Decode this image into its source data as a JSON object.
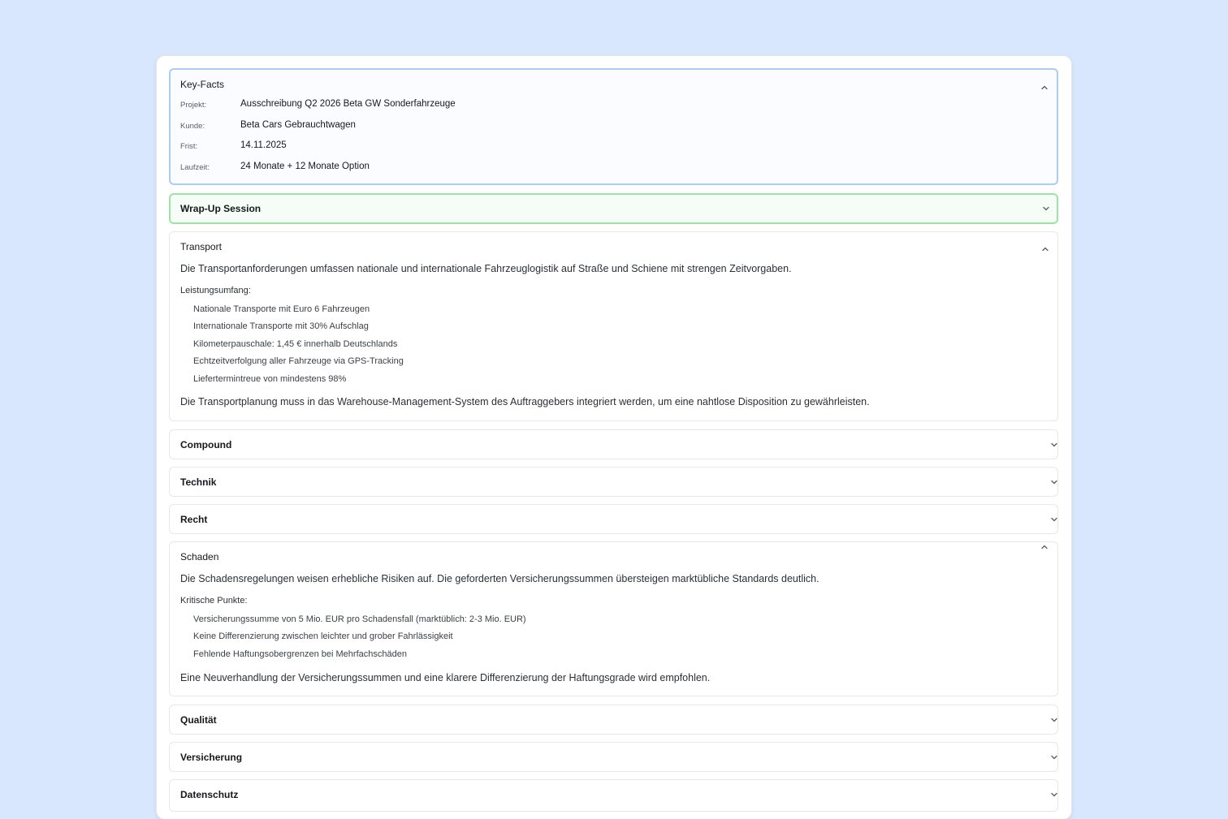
{
  "key_facts": {
    "title": "Key-Facts",
    "rows": [
      {
        "label": "Projekt:",
        "value": "Ausschreibung Q2 2026 Beta GW Sonderfahrzeuge"
      },
      {
        "label": "Kunde:",
        "value": "Beta Cars Gebrauchtwagen"
      },
      {
        "label": "Frist:",
        "value": "14.11.2025"
      },
      {
        "label": "Laufzeit:",
        "value": "24 Monate + 12 Monate Option"
      }
    ]
  },
  "wrap_up": {
    "title": "Wrap-Up Session"
  },
  "transport": {
    "title": "Transport",
    "intro": "Die Transportanforderungen umfassen nationale und internationale Fahrzeuglogistik auf Straße und Schiene mit strengen Zeitvorgaben.",
    "list_label": "Leistungsumfang:",
    "items": [
      "Nationale Transporte mit Euro 6 Fahrzeugen",
      "Internationale Transporte mit 30% Aufschlag",
      "Kilometerpauschale: 1,45 € innerhalb Deutschlands",
      "Echtzeitverfolgung aller Fahrzeuge via GPS-Tracking",
      "Liefertermintreue von mindestens 98%"
    ],
    "outro": "Die Transportplanung muss in das Warehouse-Management-System des Auftraggebers integriert werden, um eine nahtlose Disposition zu gewährleisten."
  },
  "collapsed": {
    "compound": "Compound",
    "technik": "Technik",
    "recht": "Recht",
    "qualitaet": "Qualität",
    "versicherung": "Versicherung",
    "datenschutz": "Datenschutz"
  },
  "schaden": {
    "title": "Schaden",
    "intro": "Die Schadensregelungen weisen erhebliche Risiken auf. Die geforderten Versicherungssummen übersteigen marktübliche Standards deutlich.",
    "list_label": "Kritische Punkte:",
    "items": [
      "Versicherungssumme von 5 Mio. EUR pro Schadensfall (marktüblich: 2-3 Mio. EUR)",
      "Keine Differenzierung zwischen leichter und grober Fahrlässigkeit",
      "Fehlende Haftungsobergrenzen bei Mehrfachschäden"
    ],
    "outro": "Eine Neuverhandlung der Versicherungssummen und eine klarere Differenzierung der Haftungsgrade wird empfohlen."
  },
  "colors": {
    "background": "#d8e7fd",
    "keyfacts_border": "#a9cdf5",
    "wrapup_border": "#9be3a7"
  }
}
